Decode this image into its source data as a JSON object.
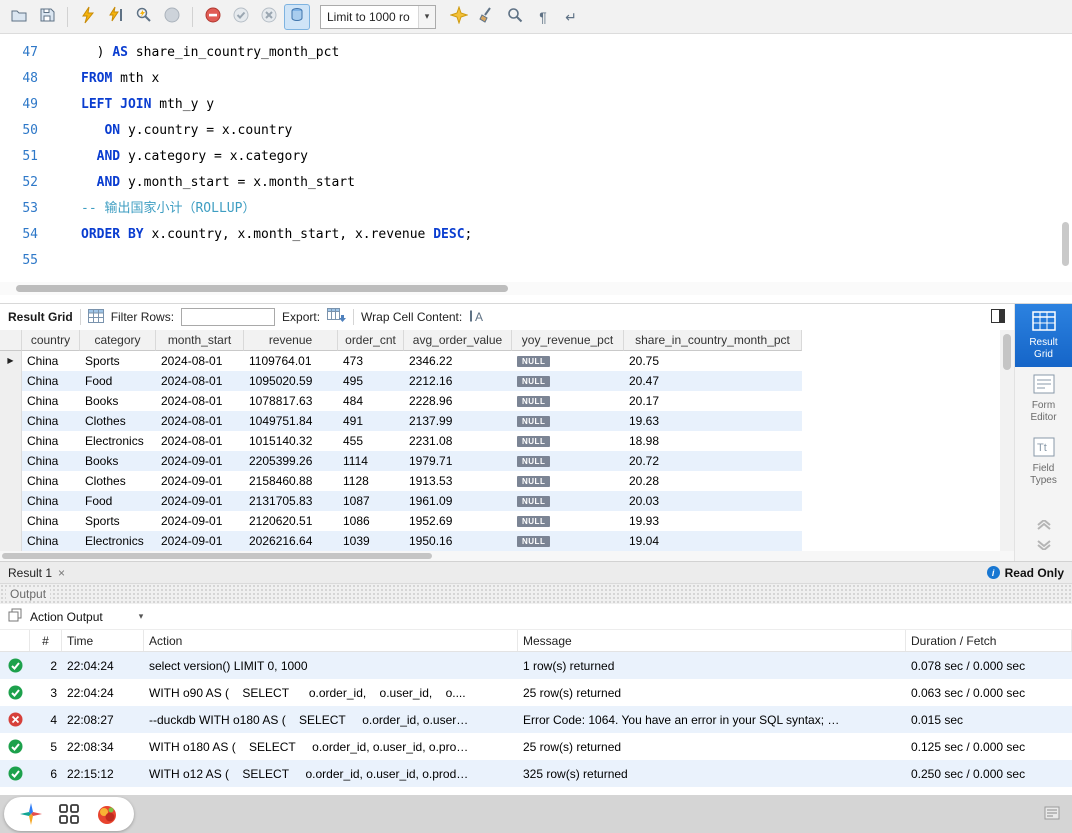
{
  "glyphs": {
    "dropdown_arrow": "▾",
    "close": "×",
    "pilcrow": "¶",
    "wrap_return": "↵",
    "info": "i",
    "row_marker": "▶"
  },
  "toolbar": {
    "limit_dropdown": "Limit to 1000 ro"
  },
  "editor": {
    "lines": [
      {
        "num": "47",
        "segments": [
          [
            "plain",
            "  ) "
          ],
          [
            "kw",
            "AS"
          ],
          [
            "plain",
            " share_in_country_month_pct"
          ]
        ]
      },
      {
        "num": "48",
        "segments": [
          [
            "kw",
            "FROM"
          ],
          [
            "plain",
            " mth x"
          ]
        ]
      },
      {
        "num": "49",
        "segments": [
          [
            "kw",
            "LEFT JOIN"
          ],
          [
            "plain",
            " mth_y y"
          ]
        ]
      },
      {
        "num": "50",
        "segments": [
          [
            "plain",
            "   "
          ],
          [
            "kw",
            "ON"
          ],
          [
            "plain",
            " y.country = x.country"
          ]
        ]
      },
      {
        "num": "51",
        "segments": [
          [
            "plain",
            "  "
          ],
          [
            "kw",
            "AND"
          ],
          [
            "plain",
            " y.category = x.category"
          ]
        ]
      },
      {
        "num": "52",
        "segments": [
          [
            "plain",
            "  "
          ],
          [
            "kw",
            "AND"
          ],
          [
            "plain",
            " y.month_start = x.month_start"
          ]
        ]
      },
      {
        "num": "53",
        "segments": [
          [
            "comment",
            "-- 输出国家小计（ROLLUP）"
          ]
        ]
      },
      {
        "num": "54",
        "segments": [
          [
            "kw",
            "ORDER BY"
          ],
          [
            "plain",
            " x.country, x.month_start, x.revenue "
          ],
          [
            "kw",
            "DESC"
          ],
          [
            "plain",
            ";"
          ]
        ]
      },
      {
        "num": "55",
        "segments": []
      }
    ]
  },
  "result_toolbar": {
    "title": "Result Grid",
    "filter_label": "Filter Rows:",
    "export_label": "Export:",
    "wrap_label": "Wrap Cell Content:"
  },
  "grid": {
    "columns": [
      "country",
      "category",
      "month_start",
      "revenue",
      "order_cnt",
      "avg_order_value",
      "yoy_revenue_pct",
      "share_in_country_month_pct"
    ],
    "rows": [
      [
        "China",
        "Sports",
        "2024-08-01",
        "1109764.01",
        "473",
        "2346.22",
        "NULL",
        "20.75"
      ],
      [
        "China",
        "Food",
        "2024-08-01",
        "1095020.59",
        "495",
        "2212.16",
        "NULL",
        "20.47"
      ],
      [
        "China",
        "Books",
        "2024-08-01",
        "1078817.63",
        "484",
        "2228.96",
        "NULL",
        "20.17"
      ],
      [
        "China",
        "Clothes",
        "2024-08-01",
        "1049751.84",
        "491",
        "2137.99",
        "NULL",
        "19.63"
      ],
      [
        "China",
        "Electronics",
        "2024-08-01",
        "1015140.32",
        "455",
        "2231.08",
        "NULL",
        "18.98"
      ],
      [
        "China",
        "Books",
        "2024-09-01",
        "2205399.26",
        "1114",
        "1979.71",
        "NULL",
        "20.72"
      ],
      [
        "China",
        "Clothes",
        "2024-09-01",
        "2158460.88",
        "1128",
        "1913.53",
        "NULL",
        "20.28"
      ],
      [
        "China",
        "Food",
        "2024-09-01",
        "2131705.83",
        "1087",
        "1961.09",
        "NULL",
        "20.03"
      ],
      [
        "China",
        "Sports",
        "2024-09-01",
        "2120620.51",
        "1086",
        "1952.69",
        "NULL",
        "19.93"
      ],
      [
        "China",
        "Electronics",
        "2024-09-01",
        "2026216.64",
        "1039",
        "1950.16",
        "NULL",
        "19.04"
      ]
    ]
  },
  "side_panel": {
    "items": [
      {
        "line1": "Result",
        "line2": "Grid"
      },
      {
        "line1": "Form",
        "line2": "Editor"
      },
      {
        "line1": "Field",
        "line2": "Types"
      }
    ]
  },
  "result_tabs": {
    "tab": "Result 1",
    "read_only": "Read Only"
  },
  "output": {
    "title": "Output",
    "view_selector": "Action Output",
    "columns": [
      "#",
      "Time",
      "Action",
      "Message",
      "Duration / Fetch"
    ],
    "rows": [
      {
        "status": "ok",
        "index": "2",
        "time": "22:04:24",
        "action": "select version() LIMIT 0, 1000",
        "message": "1 row(s) returned",
        "duration": "0.078 sec / 0.000 sec"
      },
      {
        "status": "ok",
        "index": "3",
        "time": "22:04:24",
        "action": "WITH o90 AS (    SELECT      o.order_id,    o.user_id,    o....",
        "message": "25 row(s) returned",
        "duration": "0.063 sec / 0.000 sec"
      },
      {
        "status": "error",
        "index": "4",
        "time": "22:08:27",
        "action": "--duckdb WITH o180 AS (    SELECT     o.order_id, o.user…",
        "message": "Error Code: 1064. You have an error in your SQL syntax; …",
        "duration": "0.015 sec"
      },
      {
        "status": "ok",
        "index": "5",
        "time": "22:08:34",
        "action": "WITH o180 AS (    SELECT     o.order_id, o.user_id, o.pro…",
        "message": "25 row(s) returned",
        "duration": "0.125 sec / 0.000 sec"
      },
      {
        "status": "ok",
        "index": "6",
        "time": "22:15:12",
        "action": "WITH o12 AS (    SELECT     o.order_id, o.user_id, o.prod…",
        "message": "325 row(s) returned",
        "duration": "0.250 sec / 0.000 sec"
      }
    ]
  }
}
